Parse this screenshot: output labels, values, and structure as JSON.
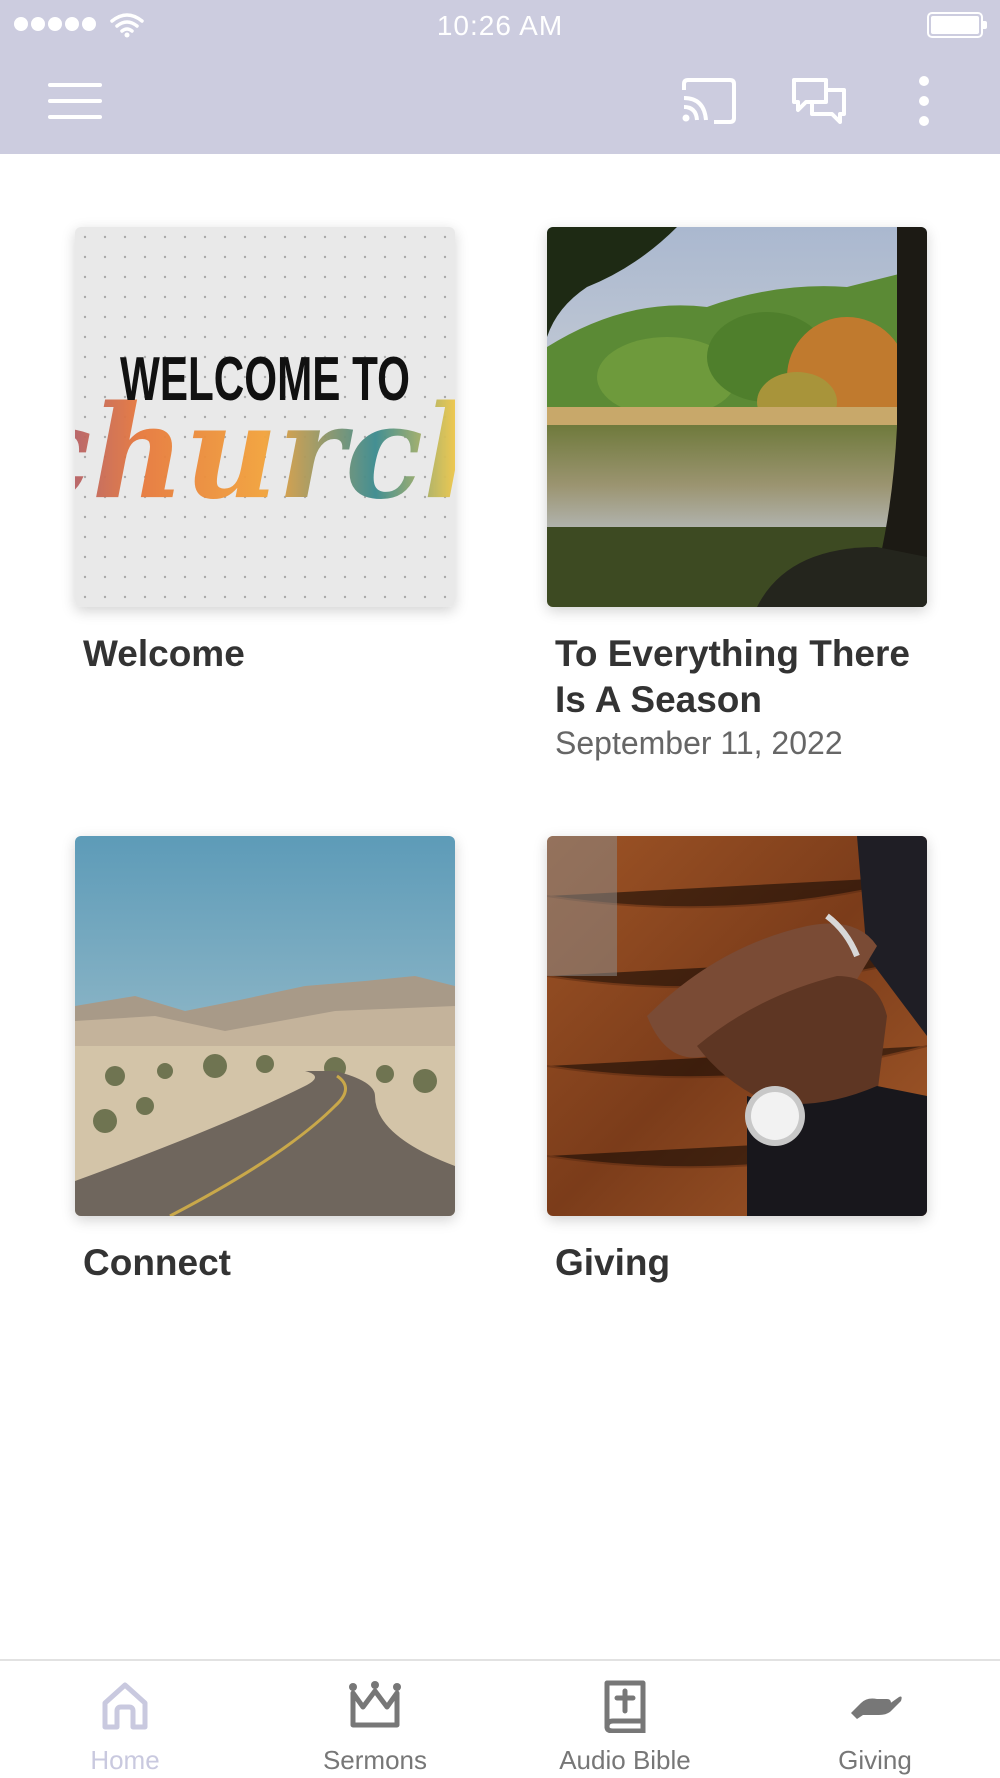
{
  "status_bar": {
    "time": "10:26 AM"
  },
  "app_bar": {
    "icons": [
      "menu-icon",
      "cast-icon",
      "chat-icon",
      "more-vert-icon"
    ]
  },
  "cards": [
    {
      "title": "Welcome",
      "subtitle": "",
      "image": {
        "headline": "WELCOME TO",
        "script": "church"
      }
    },
    {
      "title": "To Everything There Is A Season",
      "subtitle": "September 11, 2022",
      "image": {}
    },
    {
      "title": "Connect",
      "subtitle": "",
      "image": {}
    },
    {
      "title": "Giving",
      "subtitle": "",
      "image": {}
    }
  ],
  "tab_bar": {
    "items": [
      {
        "label": "Home",
        "icon": "home-icon",
        "active": true
      },
      {
        "label": "Sermons",
        "icon": "crown-icon",
        "active": false
      },
      {
        "label": "Audio Bible",
        "icon": "bible-icon",
        "active": false
      },
      {
        "label": "Giving",
        "icon": "giving-icon",
        "active": false
      }
    ]
  },
  "colors": {
    "header_bg": "#ccccdf",
    "active_tab": "#c9c9df",
    "inactive_tab": "#777777",
    "title_text": "#333333",
    "subtitle_text": "#666666"
  }
}
